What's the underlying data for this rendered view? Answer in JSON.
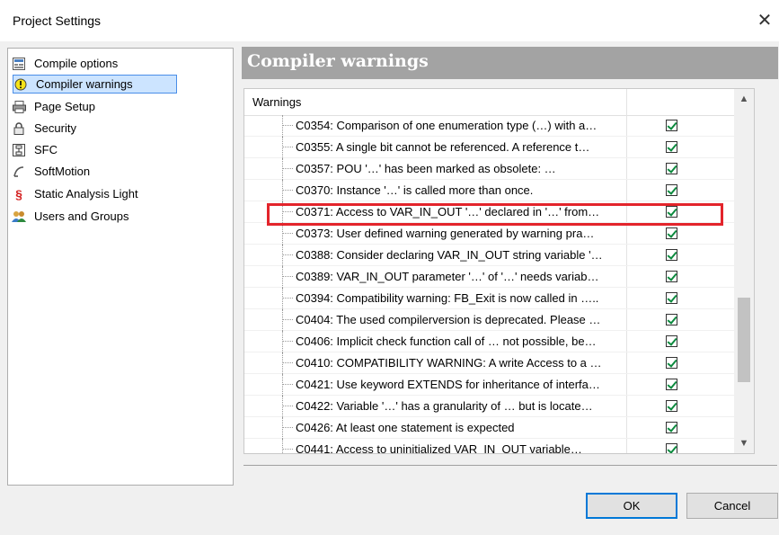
{
  "window": {
    "title": "Project Settings",
    "close_glyph": "✕"
  },
  "sidebar": {
    "items": [
      {
        "label": "Compile options",
        "icon": "compile-options-icon"
      },
      {
        "label": "Compiler warnings",
        "icon": "warning-icon",
        "selected": true
      },
      {
        "label": "Page Setup",
        "icon": "printer-icon"
      },
      {
        "label": "Security",
        "icon": "lock-icon"
      },
      {
        "label": "SFC",
        "icon": "sfc-icon"
      },
      {
        "label": "SoftMotion",
        "icon": "softmotion-icon"
      },
      {
        "label": "Static Analysis Light",
        "icon": "section-icon"
      },
      {
        "label": "Users and Groups",
        "icon": "users-icon"
      }
    ]
  },
  "panel": {
    "header": "Compiler warnings",
    "column_header": "Warnings"
  },
  "warnings": [
    {
      "text": "C0354: Comparison of one enumeration type (…) with a…",
      "checked": true
    },
    {
      "text": "C0355: A single bit cannot be referenced. A reference t…",
      "checked": true
    },
    {
      "text": "C0357: POU '…' has been marked as obsolete: …",
      "checked": true
    },
    {
      "text": "C0370: Instance '…' is called more than once.",
      "checked": true
    },
    {
      "text": "C0371: Access to VAR_IN_OUT '…' declared in '…' from…",
      "checked": true,
      "highlighted": true
    },
    {
      "text": "C0373: User defined warning generated by warning pra…",
      "checked": true
    },
    {
      "text": "C0388: Consider declaring VAR_IN_OUT string variable '…",
      "checked": true
    },
    {
      "text": "C0389: VAR_IN_OUT parameter '…' of '…' needs variab…",
      "checked": true
    },
    {
      "text": "C0394: Compatibility warning: FB_Exit is now called in …..",
      "checked": true
    },
    {
      "text": "C0404: The used compilerversion is deprecated. Please …",
      "checked": true
    },
    {
      "text": "C0406: Implicit check function call of … not possible, be…",
      "checked": true
    },
    {
      "text": "C0410: COMPATIBILITY WARNING: A write Access to a …",
      "checked": true
    },
    {
      "text": "C0421: Use keyword EXTENDS for inheritance of interfa…",
      "checked": true
    },
    {
      "text": "C0422: Variable '…' has a granularity of … but is locate…",
      "checked": true
    },
    {
      "text": "C0426: At least one statement is expected",
      "checked": true
    },
    {
      "text": "C0441: Access to uninitialized VAR_IN_OUT variable…",
      "checked": true
    }
  ],
  "buttons": {
    "ok": "OK",
    "cancel": "Cancel"
  }
}
